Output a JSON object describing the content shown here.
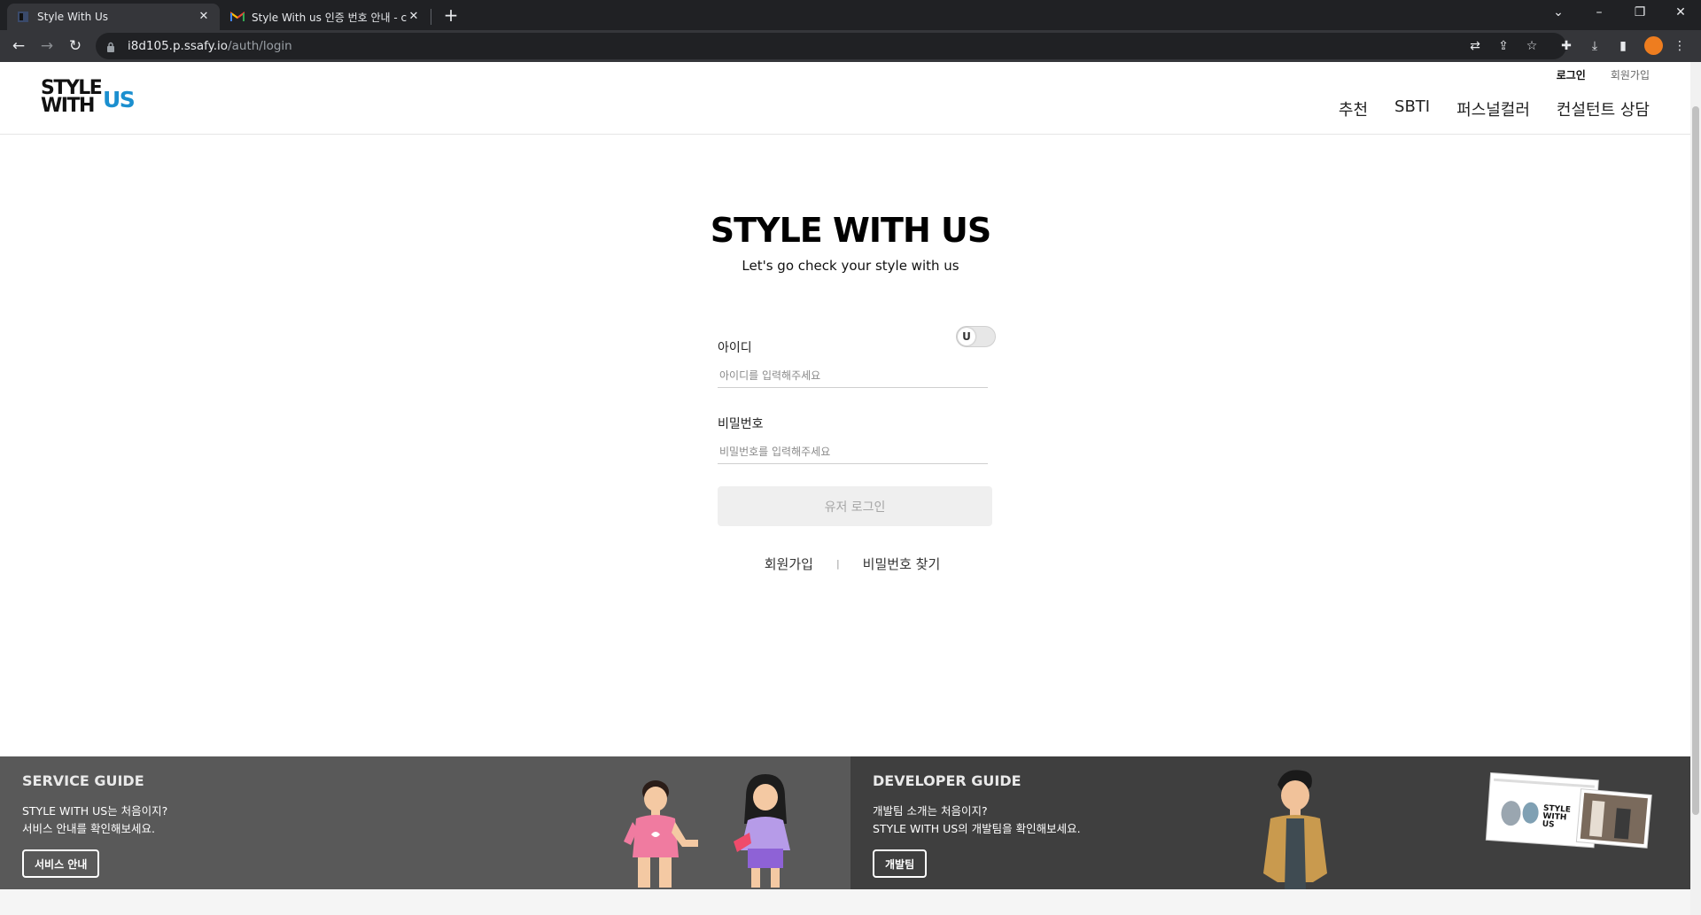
{
  "browser": {
    "tabs": [
      {
        "title": "Style With Us",
        "active": true
      },
      {
        "title": "Style With us 인증 번호 안내 - c",
        "active": false
      }
    ],
    "url_host": "i8d105.p.ssafy.io",
    "url_path": "/auth/login",
    "profile_color": "#ee7d1f"
  },
  "header": {
    "logo_line1": "STYLE",
    "logo_line2": "WITH",
    "logo_accent": "US",
    "accent_color": "#1b8fcf",
    "top_links": {
      "login": "로그인",
      "signup": "회원가입"
    },
    "nav": [
      "추천",
      "SBTI",
      "퍼스널컬러",
      "컨설턴트 상담"
    ]
  },
  "login": {
    "title": "STYLE WITH US",
    "subtitle": "Let's go check your style with us",
    "toggle_label": "U",
    "id_label": "아이디",
    "id_placeholder": "아이디를 입력해주세요",
    "pw_label": "비밀번호",
    "pw_placeholder": "비밀번호를 입력해주세요",
    "submit_label": "유저 로그인",
    "signup_link": "회원가입",
    "separator": "|",
    "find_pw_link": "비밀번호 찾기"
  },
  "footer": {
    "service": {
      "title": "SERVICE GUIDE",
      "line1": "STYLE WITH US는 처음이지?",
      "line2": "서비스 안내를 확인해보세요.",
      "button": "서비스 안내"
    },
    "developer": {
      "title": "DEVELOPER GUIDE",
      "line1": "개발팀 소개는 처음이지?",
      "line2": "STYLE WITH US의 개발팀을 확인해보세요.",
      "button": "개발팀"
    }
  }
}
